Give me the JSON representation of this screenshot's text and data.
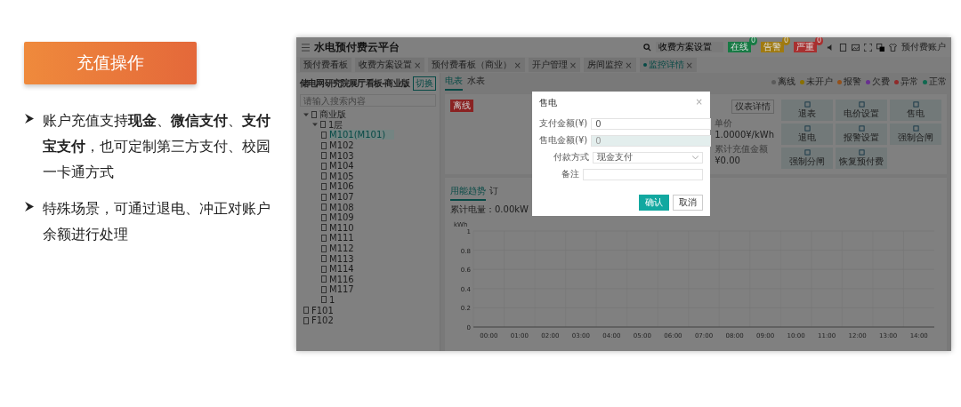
{
  "slide": {
    "title": "充值操作",
    "bullets": [
      "账户充值支持**现金**、**微信支付**、**支付宝支付**，也可定制第三方支付、校园一卡通方式",
      "特殊场景，可通过退电、冲正对账户余额进行处理"
    ]
  },
  "app": {
    "title": "水电预付费云平台",
    "search": {
      "value": "收费方案设置"
    },
    "status_badges": [
      {
        "label": "在线",
        "count": "0",
        "color": "#177a44"
      },
      {
        "label": "告警",
        "count": "0",
        "color": "#a07a10"
      },
      {
        "label": "严重",
        "count": "0",
        "color": "#a83030"
      }
    ],
    "user": "预付费账户",
    "tabs": [
      {
        "label": "预付费看板",
        "selected": false
      },
      {
        "label": "收费方案设置",
        "selected": false,
        "close": "×"
      },
      {
        "label": "预付费看板（商业）",
        "selected": false,
        "close": "×"
      },
      {
        "label": "开户管理",
        "selected": false,
        "close": "×"
      },
      {
        "label": "房间监控",
        "selected": false,
        "close": "×"
      },
      {
        "label": "监控详情",
        "selected": true,
        "close": "×"
      }
    ],
    "sidebar": {
      "title": "储电网研究院展厅看板-商业版",
      "switch_button": "切换",
      "search": {
        "placeholder": "请输入搜索内容"
      },
      "tree": [
        {
          "label": "商业版",
          "selected": false,
          "expanded": true,
          "children": [
            {
              "label": "1层",
              "selected": false,
              "expanded": true,
              "children": [
                {
                  "label": "M101(M101)",
                  "selected": true
                },
                {
                  "label": "M102",
                  "selected": false
                },
                {
                  "label": "M103",
                  "selected": false
                },
                {
                  "label": "M104",
                  "selected": false
                },
                {
                  "label": "M105",
                  "selected": false
                },
                {
                  "label": "M106",
                  "selected": false
                },
                {
                  "label": "M107",
                  "selected": false
                },
                {
                  "label": "M108",
                  "selected": false
                },
                {
                  "label": "M109",
                  "selected": false
                },
                {
                  "label": "M110",
                  "selected": false
                },
                {
                  "label": "M111",
                  "selected": false
                },
                {
                  "label": "M112",
                  "selected": false
                },
                {
                  "label": "M113",
                  "selected": false
                },
                {
                  "label": "M114",
                  "selected": false
                },
                {
                  "label": "M116",
                  "selected": false
                },
                {
                  "label": "M117",
                  "selected": false
                },
                {
                  "label": "1",
                  "selected": false
                }
              ]
            }
          ]
        },
        {
          "label": "F101",
          "selected": false
        },
        {
          "label": "F102",
          "selected": false
        }
      ]
    },
    "meter_tabs": [
      {
        "label": "电表",
        "selected": true
      },
      {
        "label": "水表",
        "selected": false
      }
    ],
    "legend": [
      {
        "label": "离线",
        "color": "#5a5a5a"
      },
      {
        "label": "未开户",
        "color": "#8a7000"
      },
      {
        "label": "报警",
        "color": "#94501a"
      },
      {
        "label": "欠费",
        "color": "#683090"
      },
      {
        "label": "异常",
        "color": "#902a2a"
      },
      {
        "label": "正常",
        "color": "#106850"
      }
    ],
    "meter": {
      "status": "离线",
      "detail_button": "仪表详情",
      "stats": [
        {
          "label": "单价",
          "value": "1.0000¥/kWh"
        },
        {
          "label": "累计充值金额",
          "value": "¥0.00"
        }
      ]
    },
    "actions": [
      "退表",
      "电价设置",
      "售电",
      "退电",
      "报警设置",
      "强制合闸",
      "强制分闸",
      "恢复预付费"
    ],
    "lower_tabs": [
      {
        "label": "用能趋势",
        "selected": true
      },
      {
        "label": "订",
        "selected": false
      }
    ],
    "total": "累计电量：0.00kW",
    "chart_data": {
      "type": "line",
      "ylabel": "kWh",
      "categories": [
        "00:00",
        "01:00",
        "02:00",
        "03:00",
        "04:00",
        "05:00",
        "06:00",
        "07:00",
        "08:00",
        "09:00",
        "10:00",
        "11:00",
        "12:00",
        "13:00",
        "14:00"
      ],
      "ylim": [
        0,
        1
      ],
      "yticks": [
        0,
        0.2,
        0.4,
        0.6,
        0.8,
        1
      ],
      "grid": true
    },
    "dialog": {
      "title": "售电",
      "close": "×",
      "fields": [
        {
          "label": "支付金额(¥)",
          "kind": "input",
          "value": "0",
          "disabled": false
        },
        {
          "label": "售电金额(¥)",
          "kind": "input",
          "value": "0",
          "disabled": true
        },
        {
          "label": "付款方式",
          "kind": "select",
          "value": "现金支付",
          "disabled": false
        },
        {
          "label": "备注",
          "kind": "input",
          "disabled": false
        }
      ],
      "buttons": [
        {
          "label": "确认",
          "primary": true
        },
        {
          "label": "取消",
          "primary": false
        }
      ]
    }
  }
}
